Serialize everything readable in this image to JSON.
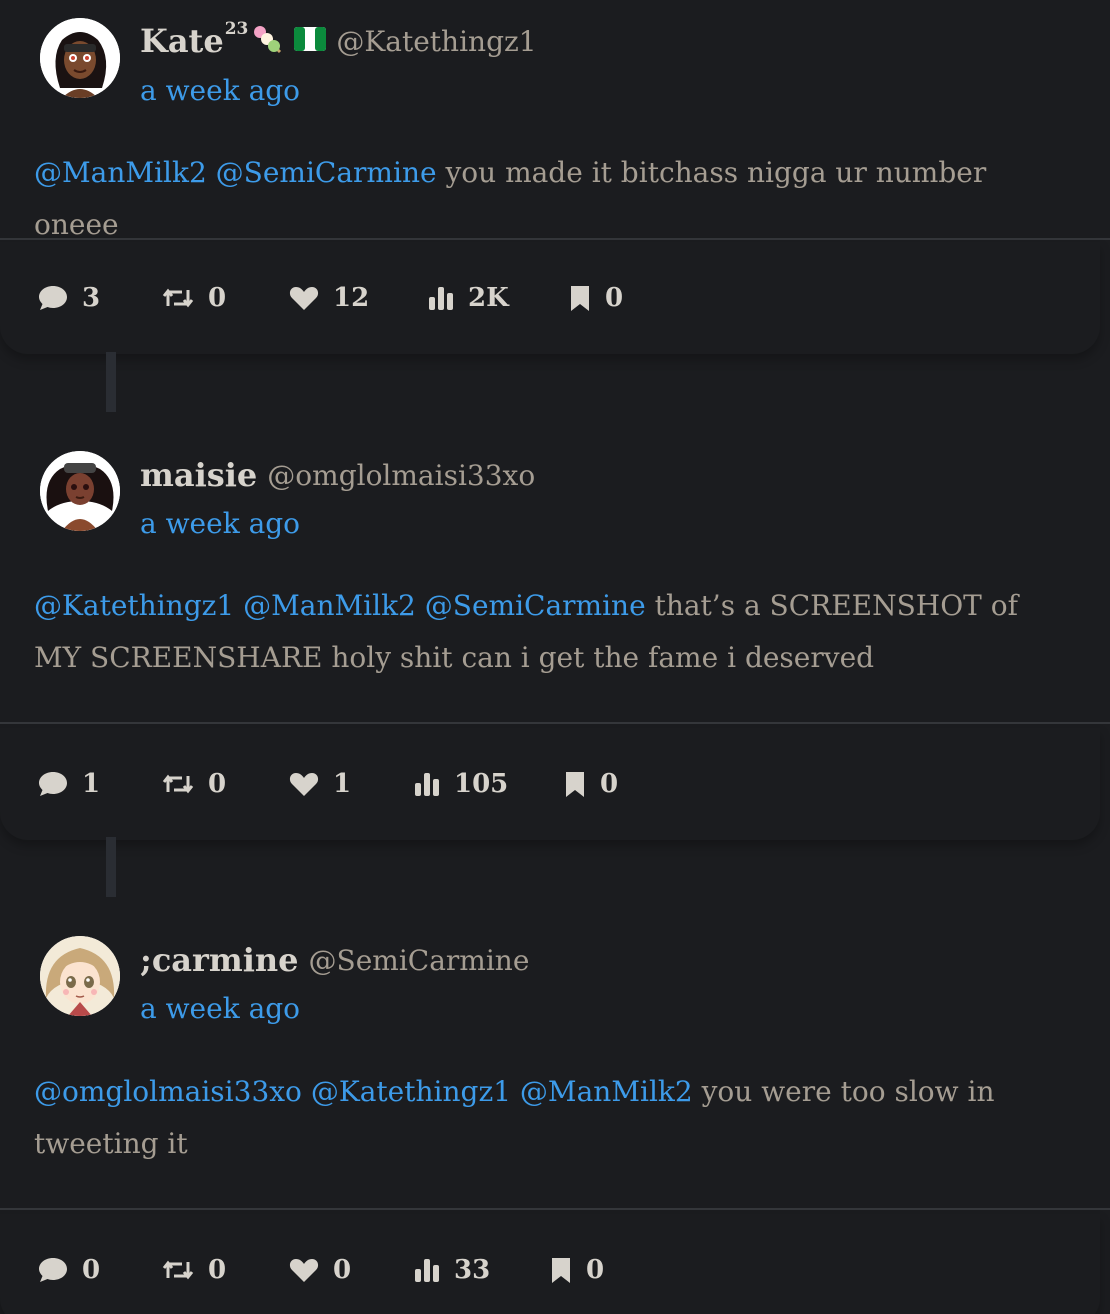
{
  "tweets": [
    {
      "name": "Kate",
      "name_sup": "23",
      "has_emoji": true,
      "handle": "@Katethingz1",
      "time": "a week ago",
      "mentions": [
        "@ManMilk2",
        "@SemiCarmine"
      ],
      "text": "you made it bitchass nigga ur number oneee",
      "stats": {
        "replies": "3",
        "retweets": "0",
        "likes": "12",
        "views": "2K",
        "bookmarks": "0"
      }
    },
    {
      "name": "maisie",
      "name_sup": "",
      "has_emoji": false,
      "handle": "@omglolmaisi33xo",
      "time": "a week ago",
      "mentions": [
        "@Katethingz1",
        "@ManMilk2",
        "@SemiCarmine"
      ],
      "text": "that’s a SCREENSHOT of MY SCREENSHARE holy shit can i get the fame i deserved",
      "stats": {
        "replies": "1",
        "retweets": "0",
        "likes": "1",
        "views": "105",
        "bookmarks": "0"
      }
    },
    {
      "name": ";carmine",
      "name_sup": "",
      "has_emoji": false,
      "handle": "@SemiCarmine",
      "time": "a week ago",
      "mentions": [
        "@omglolmaisi33xo",
        "@Katethingz1",
        "@ManMilk2"
      ],
      "text": "you were too slow in tweeting it",
      "stats": {
        "replies": "0",
        "retweets": "0",
        "likes": "0",
        "views": "33",
        "bookmarks": "0"
      }
    }
  ],
  "icons": {
    "reply": "speech-bubble-icon",
    "retweet": "retweet-icon",
    "like": "heart-icon",
    "views": "bar-chart-icon",
    "bookmark": "bookmark-icon"
  },
  "colors": {
    "background": "#1b1c1f",
    "link": "#3d9be9",
    "text": "#a59d92",
    "name": "#d7d3cc",
    "divider": "#34363a"
  }
}
